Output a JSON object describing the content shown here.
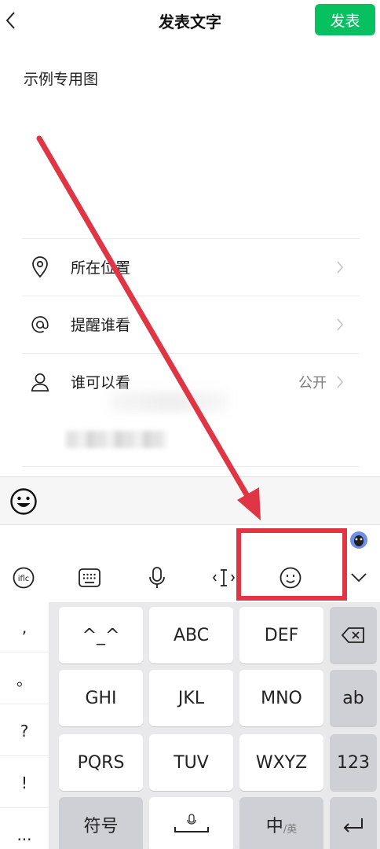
{
  "header": {
    "title": "发表文字",
    "publish_label": "发表"
  },
  "post": {
    "text": "示例专用图"
  },
  "options": [
    {
      "label": "所在位置",
      "value": ""
    },
    {
      "label": "提醒谁看",
      "value": ""
    },
    {
      "label": "谁可以看",
      "value": "公开"
    }
  ],
  "keyboard": {
    "side_keys": [
      ",",
      "。",
      "?",
      "!",
      "..."
    ],
    "rows": [
      [
        "^_^",
        "ABC",
        "DEF"
      ],
      [
        "GHI",
        "JKL",
        "MNO"
      ],
      [
        "PQRS",
        "TUV",
        "WXYZ"
      ]
    ],
    "fn_keys": [
      "ab",
      "123"
    ],
    "symbol_label": "符号",
    "lang_main": "中",
    "lang_sub": "/英"
  },
  "colors": {
    "accent": "#07c160",
    "annotation": "#e03545"
  }
}
